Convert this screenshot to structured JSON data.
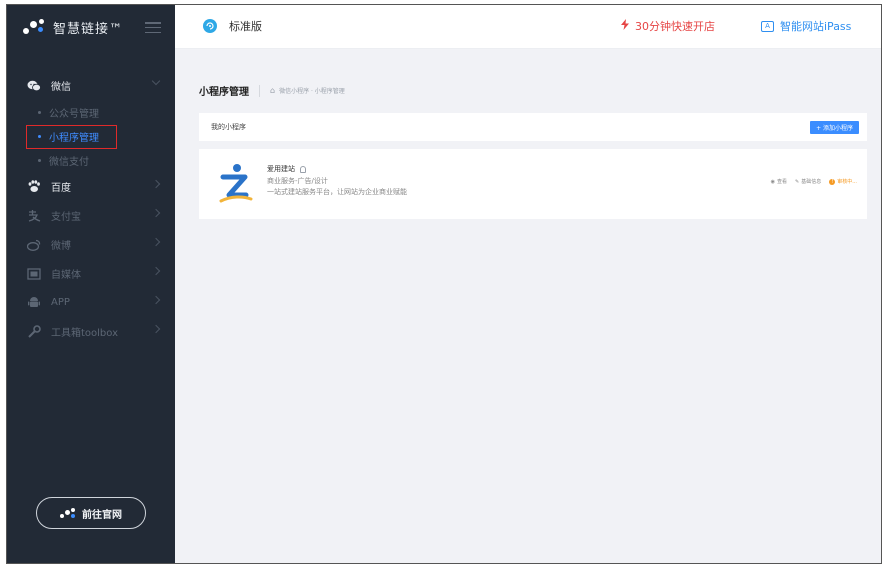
{
  "brand": {
    "name": "智慧链接™",
    "logo_icon": "network-logo-icon"
  },
  "sidebar": {
    "groups": [
      {
        "label": "微信",
        "icon": "wechat-icon",
        "expanded": true,
        "color": "#e6e9ee",
        "children": [
          {
            "label": "公众号管理",
            "active": false
          },
          {
            "label": "小程序管理",
            "active": true
          },
          {
            "label": "微信支付",
            "active": false
          }
        ]
      },
      {
        "label": "百度",
        "icon": "baidu-paw-icon",
        "color": "#e6e9ee"
      },
      {
        "label": "支付宝",
        "icon": "alipay-icon",
        "color": "#5c6674"
      },
      {
        "label": "微博",
        "icon": "weibo-icon",
        "color": "#5c6674"
      },
      {
        "label": "自媒体",
        "icon": "media-icon",
        "color": "#5c6674"
      },
      {
        "label": "APP",
        "icon": "android-icon",
        "color": "#5c6674"
      },
      {
        "label": "工具箱toolbox",
        "icon": "wrench-icon",
        "color": "#5c6674"
      }
    ],
    "goto_label": "前往官网"
  },
  "topbar": {
    "edition": "标准版",
    "quick_open": "30分钟快速开店",
    "ipass": "智能网站iPass",
    "ipass_box": "A"
  },
  "page": {
    "title": "小程序管理",
    "breadcrumb": "微信小程序 · 小程序管理"
  },
  "panel": {
    "title": "我的小程序",
    "add_label": "+ 添加小程序"
  },
  "card": {
    "name": "爱用建站",
    "category": "商业服务-广告/设计",
    "description": "一站式建站服务平台，让网站为企业商业赋能",
    "actions": {
      "view": "查看",
      "edit": "基础信息",
      "status": "审核中..."
    }
  },
  "colors": {
    "sidebar_bg": "#222a36",
    "accent": "#3b8dff",
    "highlight_border": "#e02a2a",
    "warning": "#f59a23",
    "danger": "#e64545"
  }
}
